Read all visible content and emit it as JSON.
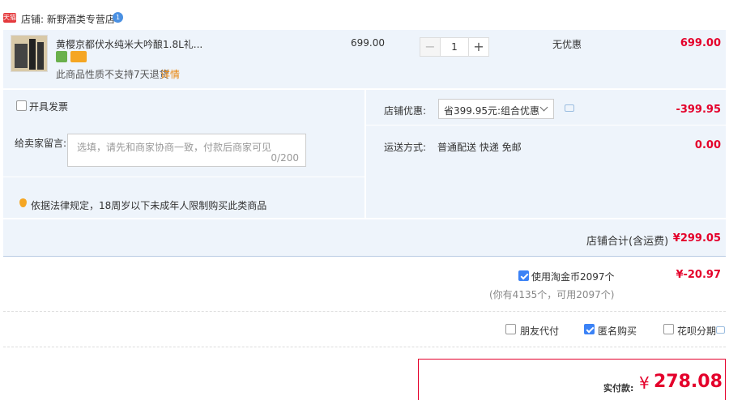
{
  "shop": {
    "badge": "天猫",
    "label": "店铺: 新野酒类专营店"
  },
  "item": {
    "title": "黄樱京都伏水纯米大吟酿1.8L礼...",
    "notice": "此商品性质不支持7天退货",
    "notice_link": "详情",
    "unit_price": "699.00",
    "quantity": "1",
    "discount": "无优惠",
    "subtotal": "699.00"
  },
  "invoice": {
    "label": "开具发票"
  },
  "shop_discount": {
    "label": "店铺优惠:",
    "selected": "省399.95元:组合优惠",
    "amount": "-399.95"
  },
  "message": {
    "label": "给卖家留言:",
    "placeholder": "选填，请先和商家协商一致，付款后商家可见",
    "counter": "0/200"
  },
  "shipping": {
    "label": "运送方式:",
    "value": "普通配送 快递 免邮",
    "amount": "0.00"
  },
  "law_notice": "依据法律规定，18周岁以下未成年人限制购买此类商品",
  "shop_total": {
    "label": "店铺合计(含运费)",
    "amount": "¥299.05"
  },
  "coins": {
    "label": "使用淘金币2097个",
    "amount": "¥-20.97",
    "sub": "(你有4135个，可用2097个)",
    "checked": true
  },
  "options": [
    {
      "label": "朋友代付",
      "checked": false
    },
    {
      "label": "匿名购买",
      "checked": true
    },
    {
      "label": "花呗分期",
      "checked": false
    }
  ],
  "payment": {
    "label": "实付款:",
    "symbol": "¥",
    "amount": "278.08"
  },
  "colors": {
    "accent": "#e4002b",
    "blue_bg": "#eef4fb",
    "checkbox_blue": "#3b82f6"
  }
}
